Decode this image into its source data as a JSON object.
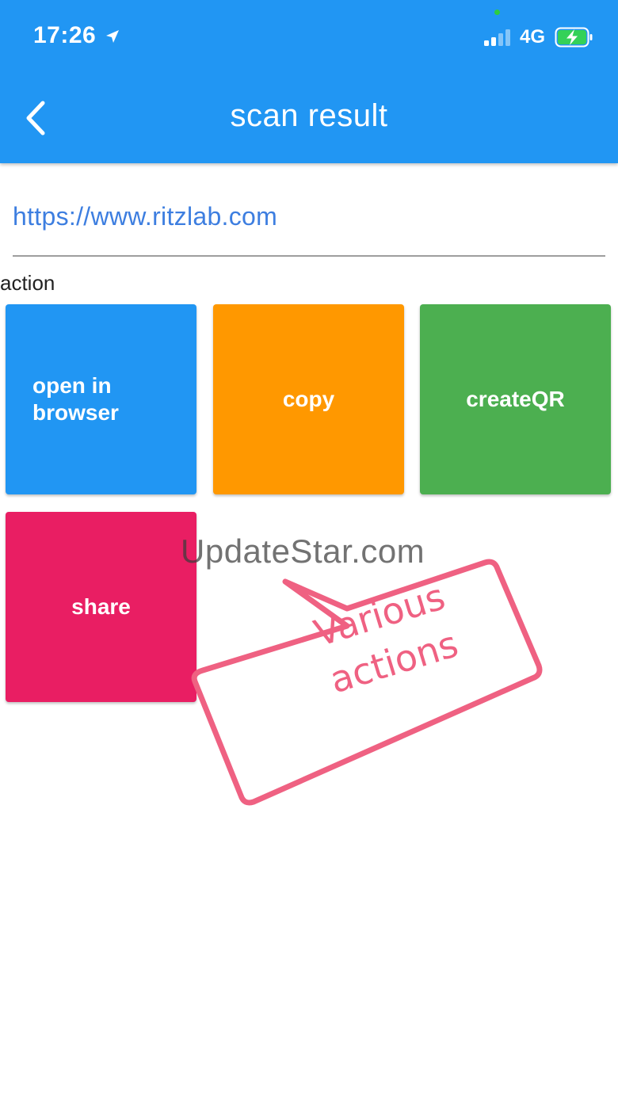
{
  "status_bar": {
    "time": "17:26",
    "network": "4G",
    "location_icon": "location-arrow-icon",
    "signal_icon": "cellular-signal-icon",
    "battery_icon": "battery-charging-icon"
  },
  "app_bar": {
    "title": "scan result",
    "back_icon": "chevron-left-icon",
    "color": "#2196f3"
  },
  "scan": {
    "url": "https://www.ritzlab.com"
  },
  "actions": {
    "label": "action",
    "items": [
      {
        "label": "open in browser",
        "color": "#2196f3"
      },
      {
        "label": "copy",
        "color": "#ff9800"
      },
      {
        "label": "createQR",
        "color": "#4caf50"
      },
      {
        "label": "share",
        "color": "#e91e63"
      }
    ]
  },
  "overlay": {
    "watermark": "UpdateStar.com",
    "callout_line1": "Various",
    "callout_line2": "actions",
    "callout_color": "#ef6182"
  }
}
